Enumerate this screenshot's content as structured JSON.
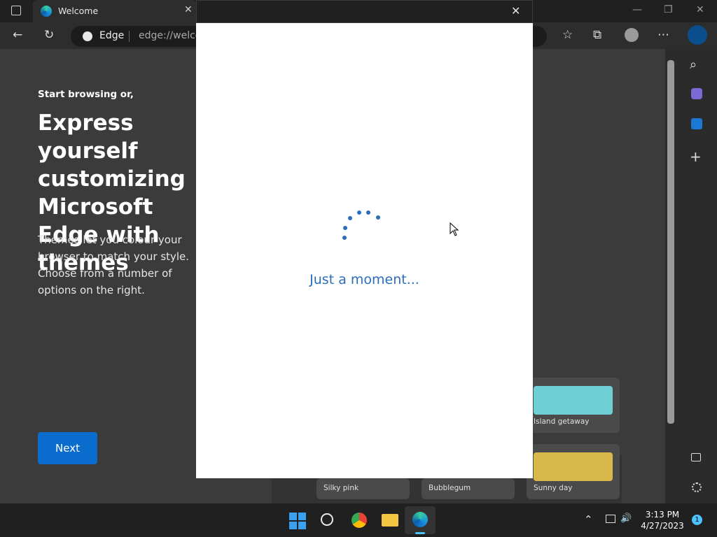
{
  "browser": {
    "tab_title": "Welcome",
    "tab_close": "✕",
    "address_prefix": "Edge",
    "address_url": "edge://welco",
    "window_controls": {
      "minimize": "—",
      "maximize": "❐",
      "close": "✕"
    }
  },
  "welcome": {
    "kicker": "Start browsing or,",
    "headline": "Express yourself customizing Microsoft Edge with themes",
    "body": "Themes let you colour your browser to match your style. Choose from a number of options on the right.",
    "next_label": "Next"
  },
  "themes": [
    {
      "label": "Island getaway",
      "color": "#6ed0d4"
    },
    {
      "label": "Sunny day",
      "color": "#d8b84a"
    },
    {
      "label": "Silky pink",
      "color": "#c9c9c9"
    },
    {
      "label": "Bubblegum",
      "color": "#c07a86"
    }
  ],
  "modal": {
    "close": "✕",
    "loading_text": "Just a moment..."
  },
  "taskbar": {
    "time": "3:13 PM",
    "date": "4/27/2023",
    "notification_count": "1"
  },
  "icons": {
    "back": "←",
    "refresh": "↻",
    "favorites": "☆",
    "collections": "⧉",
    "more": "⋯",
    "plus": "+",
    "search": "⌕",
    "chevron_up": "⌃",
    "speaker": "🔊"
  },
  "colors": {
    "accent": "#0a6dce",
    "loading": "#2a6ebb"
  }
}
